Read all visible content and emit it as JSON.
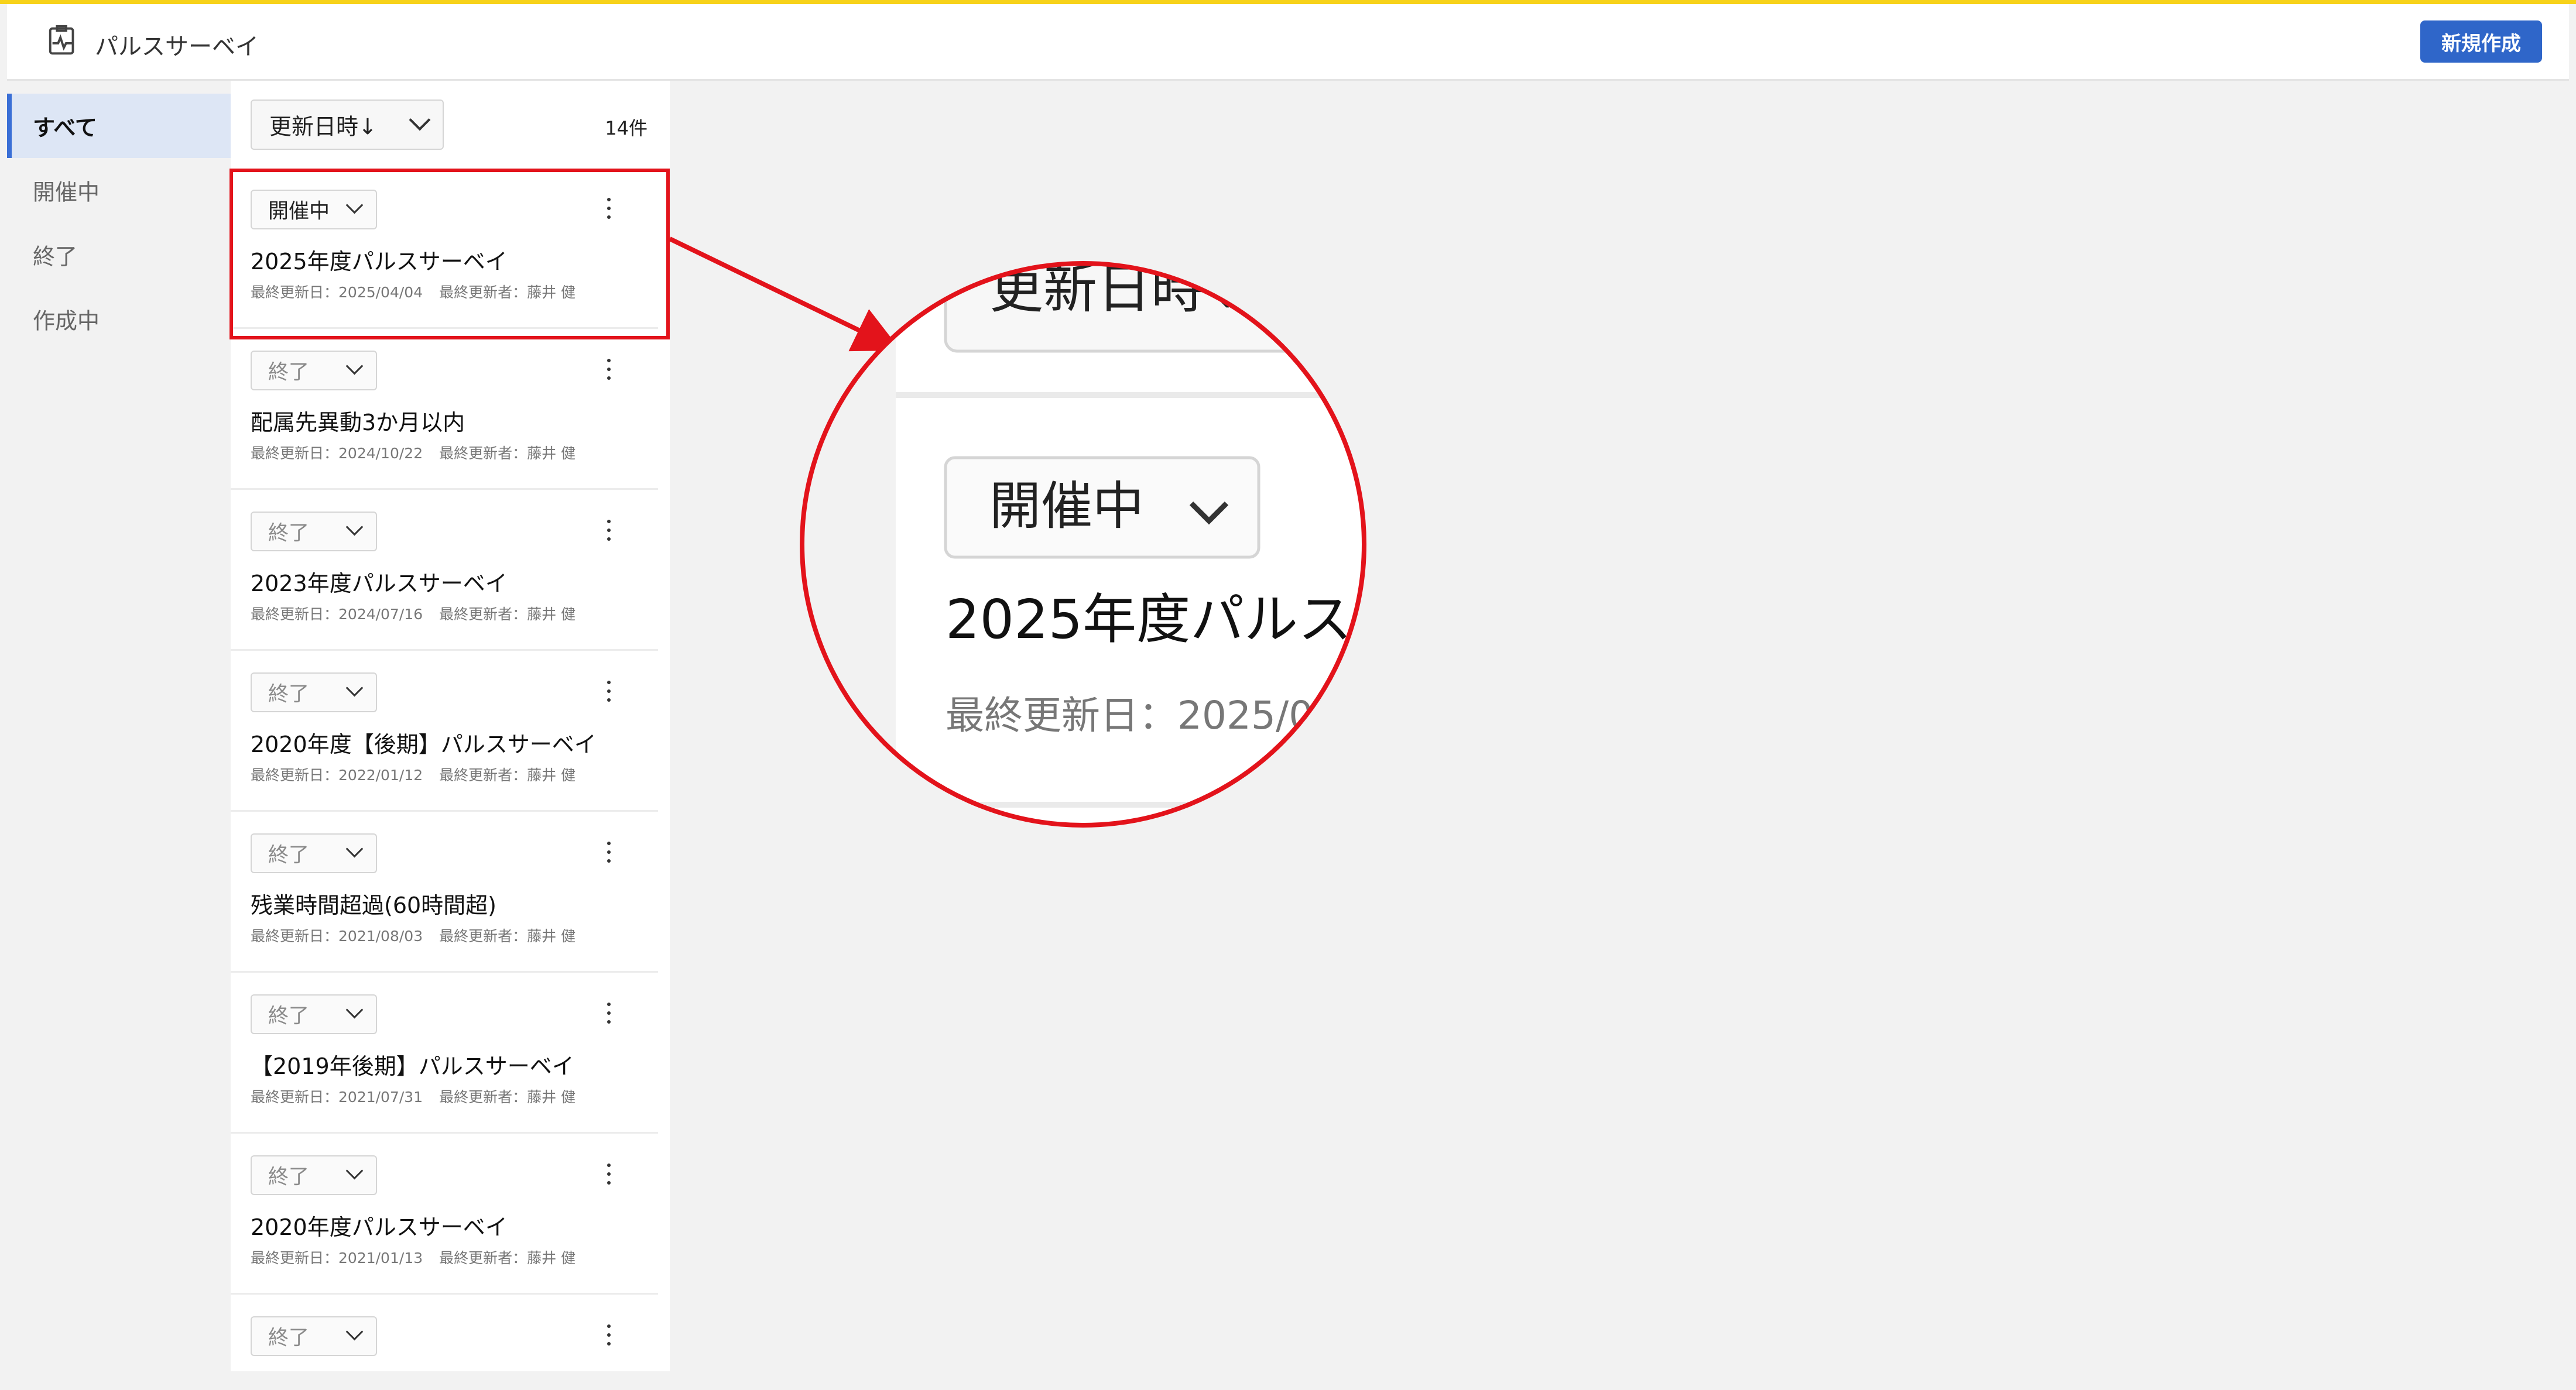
{
  "header": {
    "app_title": "パルスサーベイ",
    "new_button": "新規作成",
    "app_icon": "pulse-monitor-icon"
  },
  "nav": {
    "items": [
      {
        "label": "すべて",
        "active": true
      },
      {
        "label": "開催中",
        "active": false
      },
      {
        "label": "終了",
        "active": false
      },
      {
        "label": "作成中",
        "active": false
      }
    ]
  },
  "list": {
    "sort_label": "更新日時↓",
    "count": "14件",
    "meta_date_prefix": "最終更新日：",
    "meta_user_prefix": "最終更新者：",
    "items": [
      {
        "status": "開催中",
        "title": "2025年度パルスサーベイ",
        "date": "2025/04/04",
        "user": "藤井 健"
      },
      {
        "status": "終了",
        "title": "配属先異動3か月以内",
        "date": "2024/10/22",
        "user": "藤井 健"
      },
      {
        "status": "終了",
        "title": "2023年度パルスサーベイ",
        "date": "2024/07/16",
        "user": "藤井 健"
      },
      {
        "status": "終了",
        "title": "2020年度【後期】パルスサーベイ",
        "date": "2022/01/12",
        "user": "藤井 健"
      },
      {
        "status": "終了",
        "title": "残業時間超過(60時間超)",
        "date": "2021/08/03",
        "user": "藤井 健"
      },
      {
        "status": "終了",
        "title": "【2019年後期】パルスサーベイ",
        "date": "2021/07/31",
        "user": "藤井 健"
      },
      {
        "status": "終了",
        "title": "2020年度パルスサーベイ",
        "date": "2021/01/13",
        "user": "藤井 健"
      },
      {
        "status": "終了",
        "title": "",
        "date": "",
        "user": ""
      }
    ]
  },
  "zoom": {
    "sort_text": "更新日時↓",
    "status_text": "開催中",
    "title_text": "2025年度パルス",
    "meta_text": "最終更新日：2025/0",
    "highlight_color": "#e3131b"
  }
}
